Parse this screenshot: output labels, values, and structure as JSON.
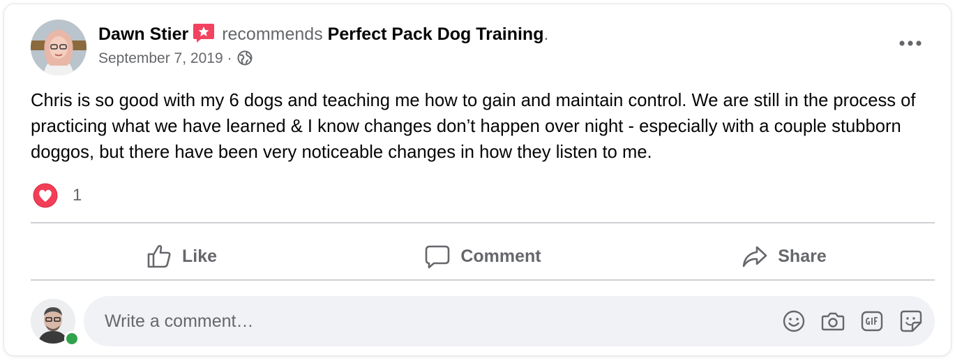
{
  "post": {
    "author": "Dawn Stier",
    "action_text": "recommends",
    "page_name": "Perfect Pack Dog Training",
    "period": ".",
    "date": "September 7, 2019",
    "separator": "·",
    "audience_icon": "globe-icon",
    "body": "Chris is so good with my 6 dogs and teaching me how to gain and maintain control.  We are still in the process of practicing what we have learned & I know changes don’t happen over night - especially with a couple stubborn doggos, but there have been very noticeable changes in how they listen to me."
  },
  "reactions": {
    "type": "love",
    "count": "1"
  },
  "actions": {
    "like": "Like",
    "comment": "Comment",
    "share": "Share"
  },
  "comment_composer": {
    "placeholder": "Write a comment…",
    "tools": [
      "emoji-icon",
      "camera-icon",
      "gif-icon",
      "sticker-icon"
    ]
  },
  "colors": {
    "secondary_text": "#65676b",
    "primary_text": "#050505",
    "recommend_badge": "#f3425f",
    "love_reaction": "#f33e58",
    "online": "#31a24c",
    "composer_bg": "#f0f2f5"
  }
}
